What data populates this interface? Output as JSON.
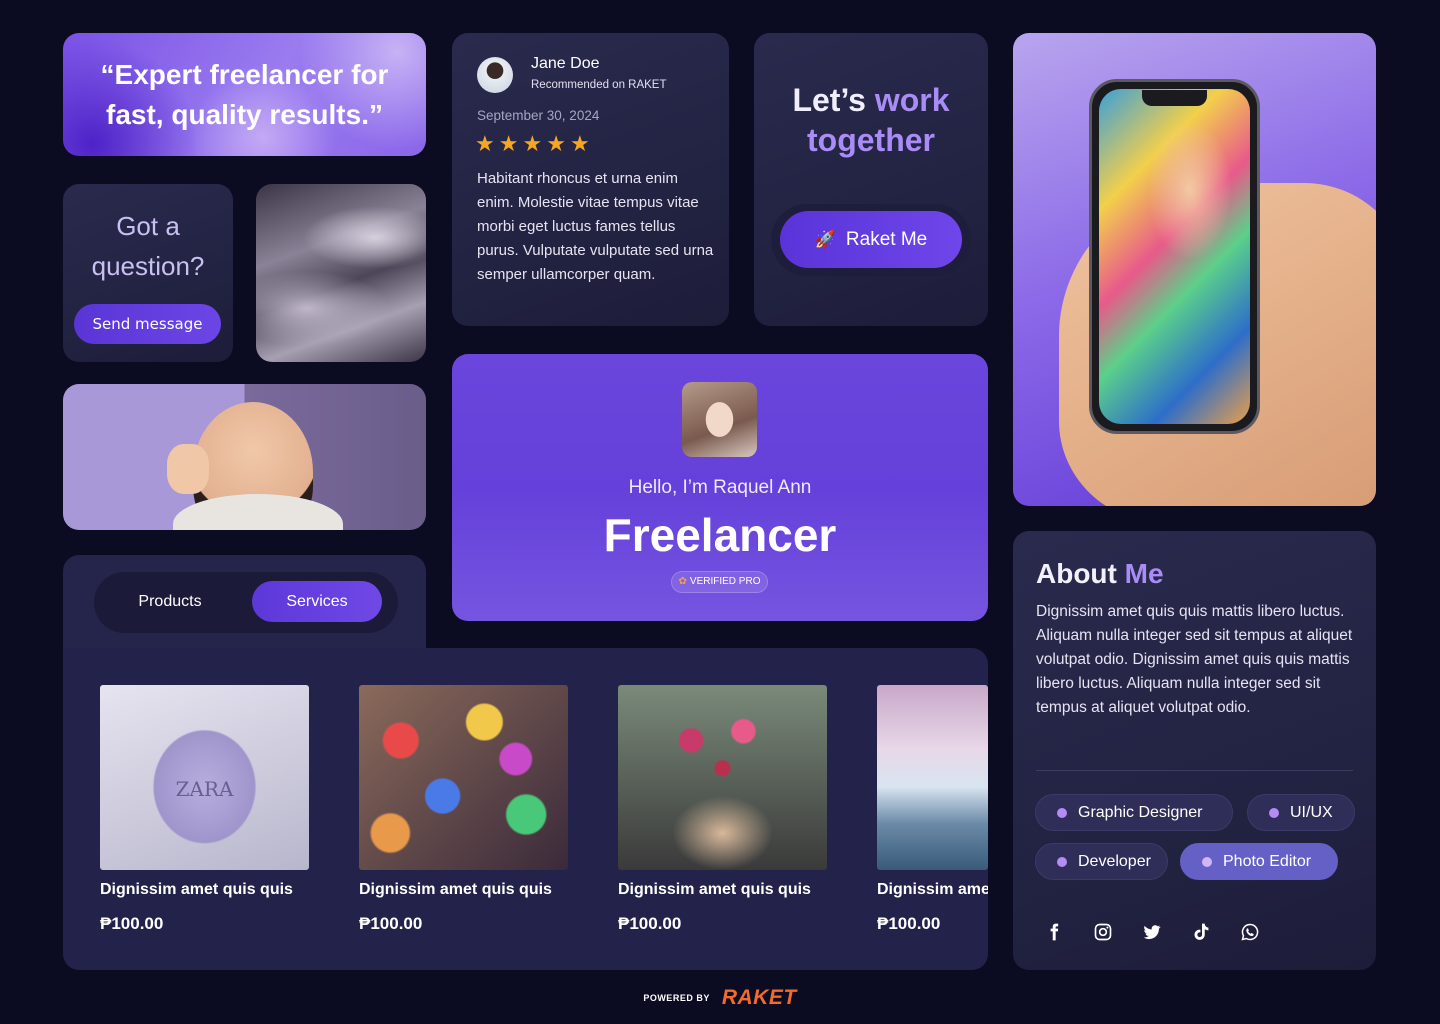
{
  "quote": {
    "text": "“Expert freelancer for fast, quality results.”"
  },
  "question": {
    "title": "Got a question?",
    "button_label": "Send message"
  },
  "review": {
    "name": "Jane Doe",
    "subtitle": "Recommended on RAKET",
    "date": "September 30, 2024",
    "rating": 5,
    "text": "Habitant rhoncus et urna enim enim. Molestie vitae tempus vitae morbi eget luctus fames tellus purus. Vulputate vulputate sed urna semper ullamcorper quam."
  },
  "work": {
    "title_part1": "Let’s ",
    "title_accent": "work",
    "title_part2": "together",
    "button_label": "Raket Me",
    "button_icon": "rocket-icon"
  },
  "profile": {
    "greeting": "Hello, I’m Raquel Ann",
    "role": "Freelancer",
    "badge": "VERIFIED PRO"
  },
  "tabs": [
    {
      "label": "Products",
      "active": false
    },
    {
      "label": "Services",
      "active": true
    }
  ],
  "products": [
    {
      "name": "Dignissim amet quis quis",
      "price": "₱100.00",
      "thumb_text": "ZARA"
    },
    {
      "name": "Dignissim amet quis quis",
      "price": "₱100.00"
    },
    {
      "name": "Dignissim amet quis quis",
      "price": "₱100.00"
    },
    {
      "name": "Dignissim amet quis quis",
      "price": "₱100.00"
    }
  ],
  "about": {
    "title_part1": "About ",
    "title_accent": "Me",
    "text": "Dignissim amet quis quis mattis libero luctus. Aliquam nulla integer sed sit tempus at aliquet volutpat odio. Dignissim amet quis quis mattis libero luctus. Aliquam nulla integer sed sit tempus at aliquet volutpat odio.",
    "skills": [
      "Graphic Designer",
      "UI/UX",
      "Developer",
      "Photo Editor"
    ],
    "socials": [
      "facebook-icon",
      "instagram-icon",
      "twitter-icon",
      "tiktok-icon",
      "whatsapp-icon"
    ]
  },
  "footer": {
    "powered_by": "POWERED BY",
    "brand": "RAKET"
  },
  "colors": {
    "accent": "#6a46dc",
    "accent_light": "#a98cf5",
    "star": "#f5a623",
    "brand": "#f36a2a"
  }
}
